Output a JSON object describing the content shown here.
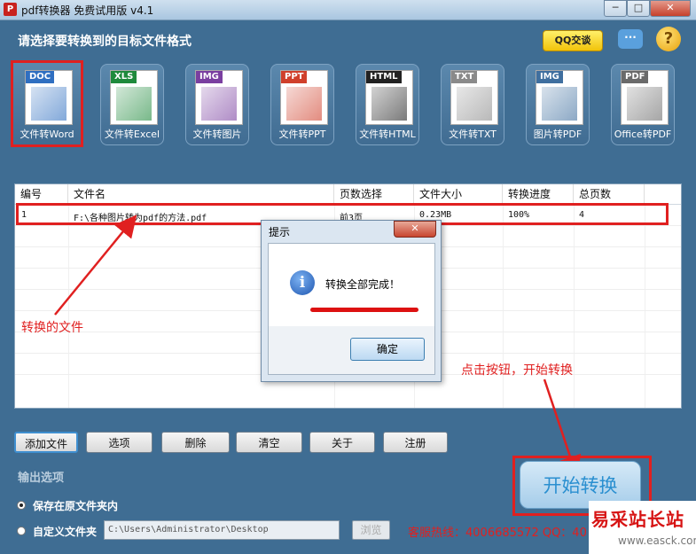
{
  "window": {
    "title": "pdf转换器 免费试用版 v4.1",
    "app_icon": "pdf-app-icon",
    "minimize": "─",
    "maximize": "□",
    "close": "✕"
  },
  "header": {
    "prompt": "请选择要转换到的目标文件格式",
    "qq_button": "QQ交谈",
    "chat_icon": "chat-bubble-icon",
    "help_icon": "question-mark-icon"
  },
  "formats": [
    {
      "tag": "DOC",
      "label": "文件转Word",
      "color": "#2f6fc1",
      "selected": true
    },
    {
      "tag": "XLS",
      "label": "文件转Excel",
      "color": "#1f8a3c",
      "selected": false
    },
    {
      "tag": "IMG",
      "label": "文件转图片",
      "color": "#7a3fa0",
      "selected": false
    },
    {
      "tag": "PPT",
      "label": "文件转PPT",
      "color": "#d0402b",
      "selected": false
    },
    {
      "tag": "HTML",
      "label": "文件转HTML",
      "color": "#222222",
      "selected": false
    },
    {
      "tag": "TXT",
      "label": "文件转TXT",
      "color": "#8a8a8a",
      "selected": false
    },
    {
      "tag": "IMG",
      "label": "图片转PDF",
      "color": "#3f6f9f",
      "selected": false
    },
    {
      "tag": "PDF",
      "label": "Office转PDF",
      "color": "#6a6a6a",
      "selected": false
    }
  ],
  "table": {
    "columns": [
      "编号",
      "文件名",
      "页数选择",
      "文件大小",
      "转换进度",
      "总页数"
    ],
    "rows": [
      {
        "id": "1",
        "filename": "F:\\各种图片转为pdf的方法.pdf",
        "pages_sel": "前3页",
        "size": "0.23MB",
        "progress": "100%",
        "total": "4"
      }
    ]
  },
  "dialog": {
    "title": "提示",
    "close": "✕",
    "message": "转换全部完成！",
    "ok": "确定",
    "icon": "info-icon"
  },
  "annotations": {
    "converted_file": "转换的文件",
    "click_start": "点击按钮，开始转换"
  },
  "toolbar": {
    "add": "添加文件",
    "options": "选项",
    "delete": "删除",
    "clear": "清空",
    "about": "关于",
    "register": "注册"
  },
  "output": {
    "label": "输出选项",
    "opt_same": "保存在原文件夹内",
    "opt_custom": "自定义文件夹",
    "path": "C:\\Users\\Administrator\\Desktop",
    "browse": "浏览",
    "selected": "opt_same"
  },
  "hotline": "客服热线：4006685572 QQ：40",
  "start_button": "开始转换",
  "watermark": {
    "text": "易采站长站",
    "url": "www.easck.com"
  },
  "colors": {
    "background": "#3f6d93",
    "highlight": "#e02020",
    "start_text": "#2a8fd0"
  }
}
